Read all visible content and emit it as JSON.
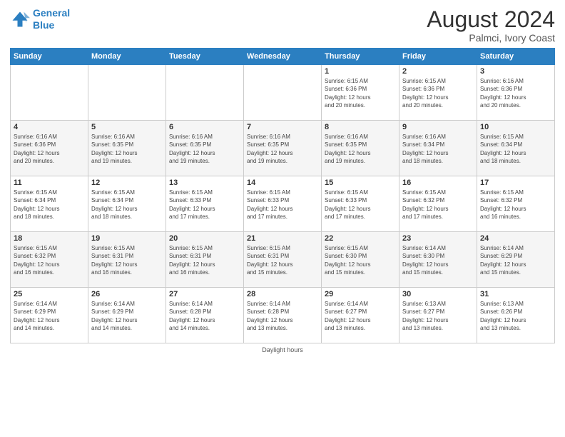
{
  "logo": {
    "line1": "General",
    "line2": "Blue"
  },
  "title": "August 2024",
  "subtitle": "Palmci, Ivory Coast",
  "weekdays": [
    "Sunday",
    "Monday",
    "Tuesday",
    "Wednesday",
    "Thursday",
    "Friday",
    "Saturday"
  ],
  "footer": "Daylight hours",
  "weeks": [
    [
      {
        "day": "",
        "info": ""
      },
      {
        "day": "",
        "info": ""
      },
      {
        "day": "",
        "info": ""
      },
      {
        "day": "",
        "info": ""
      },
      {
        "day": "1",
        "info": "Sunrise: 6:15 AM\nSunset: 6:36 PM\nDaylight: 12 hours\nand 20 minutes."
      },
      {
        "day": "2",
        "info": "Sunrise: 6:15 AM\nSunset: 6:36 PM\nDaylight: 12 hours\nand 20 minutes."
      },
      {
        "day": "3",
        "info": "Sunrise: 6:16 AM\nSunset: 6:36 PM\nDaylight: 12 hours\nand 20 minutes."
      }
    ],
    [
      {
        "day": "4",
        "info": "Sunrise: 6:16 AM\nSunset: 6:36 PM\nDaylight: 12 hours\nand 20 minutes."
      },
      {
        "day": "5",
        "info": "Sunrise: 6:16 AM\nSunset: 6:35 PM\nDaylight: 12 hours\nand 19 minutes."
      },
      {
        "day": "6",
        "info": "Sunrise: 6:16 AM\nSunset: 6:35 PM\nDaylight: 12 hours\nand 19 minutes."
      },
      {
        "day": "7",
        "info": "Sunrise: 6:16 AM\nSunset: 6:35 PM\nDaylight: 12 hours\nand 19 minutes."
      },
      {
        "day": "8",
        "info": "Sunrise: 6:16 AM\nSunset: 6:35 PM\nDaylight: 12 hours\nand 19 minutes."
      },
      {
        "day": "9",
        "info": "Sunrise: 6:16 AM\nSunset: 6:34 PM\nDaylight: 12 hours\nand 18 minutes."
      },
      {
        "day": "10",
        "info": "Sunrise: 6:15 AM\nSunset: 6:34 PM\nDaylight: 12 hours\nand 18 minutes."
      }
    ],
    [
      {
        "day": "11",
        "info": "Sunrise: 6:15 AM\nSunset: 6:34 PM\nDaylight: 12 hours\nand 18 minutes."
      },
      {
        "day": "12",
        "info": "Sunrise: 6:15 AM\nSunset: 6:34 PM\nDaylight: 12 hours\nand 18 minutes."
      },
      {
        "day": "13",
        "info": "Sunrise: 6:15 AM\nSunset: 6:33 PM\nDaylight: 12 hours\nand 17 minutes."
      },
      {
        "day": "14",
        "info": "Sunrise: 6:15 AM\nSunset: 6:33 PM\nDaylight: 12 hours\nand 17 minutes."
      },
      {
        "day": "15",
        "info": "Sunrise: 6:15 AM\nSunset: 6:33 PM\nDaylight: 12 hours\nand 17 minutes."
      },
      {
        "day": "16",
        "info": "Sunrise: 6:15 AM\nSunset: 6:32 PM\nDaylight: 12 hours\nand 17 minutes."
      },
      {
        "day": "17",
        "info": "Sunrise: 6:15 AM\nSunset: 6:32 PM\nDaylight: 12 hours\nand 16 minutes."
      }
    ],
    [
      {
        "day": "18",
        "info": "Sunrise: 6:15 AM\nSunset: 6:32 PM\nDaylight: 12 hours\nand 16 minutes."
      },
      {
        "day": "19",
        "info": "Sunrise: 6:15 AM\nSunset: 6:31 PM\nDaylight: 12 hours\nand 16 minutes."
      },
      {
        "day": "20",
        "info": "Sunrise: 6:15 AM\nSunset: 6:31 PM\nDaylight: 12 hours\nand 16 minutes."
      },
      {
        "day": "21",
        "info": "Sunrise: 6:15 AM\nSunset: 6:31 PM\nDaylight: 12 hours\nand 15 minutes."
      },
      {
        "day": "22",
        "info": "Sunrise: 6:15 AM\nSunset: 6:30 PM\nDaylight: 12 hours\nand 15 minutes."
      },
      {
        "day": "23",
        "info": "Sunrise: 6:14 AM\nSunset: 6:30 PM\nDaylight: 12 hours\nand 15 minutes."
      },
      {
        "day": "24",
        "info": "Sunrise: 6:14 AM\nSunset: 6:29 PM\nDaylight: 12 hours\nand 15 minutes."
      }
    ],
    [
      {
        "day": "25",
        "info": "Sunrise: 6:14 AM\nSunset: 6:29 PM\nDaylight: 12 hours\nand 14 minutes."
      },
      {
        "day": "26",
        "info": "Sunrise: 6:14 AM\nSunset: 6:29 PM\nDaylight: 12 hours\nand 14 minutes."
      },
      {
        "day": "27",
        "info": "Sunrise: 6:14 AM\nSunset: 6:28 PM\nDaylight: 12 hours\nand 14 minutes."
      },
      {
        "day": "28",
        "info": "Sunrise: 6:14 AM\nSunset: 6:28 PM\nDaylight: 12 hours\nand 13 minutes."
      },
      {
        "day": "29",
        "info": "Sunrise: 6:14 AM\nSunset: 6:27 PM\nDaylight: 12 hours\nand 13 minutes."
      },
      {
        "day": "30",
        "info": "Sunrise: 6:13 AM\nSunset: 6:27 PM\nDaylight: 12 hours\nand 13 minutes."
      },
      {
        "day": "31",
        "info": "Sunrise: 6:13 AM\nSunset: 6:26 PM\nDaylight: 12 hours\nand 13 minutes."
      }
    ]
  ]
}
